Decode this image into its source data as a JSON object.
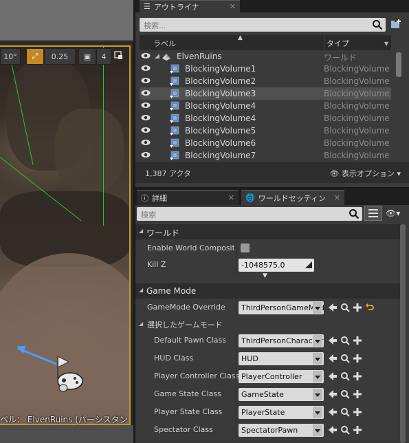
{
  "viewport": {
    "toolbar": {
      "angle": "10°",
      "scale": "0.25",
      "camera_speed": "4"
    },
    "level_label": "ベル： ElvenRuins (パーシスタント)"
  },
  "outliner": {
    "tab_label": "アウトライナ",
    "search_placeholder": "検索...",
    "col_label": "ラベル",
    "col_type": "タイプ",
    "rows": [
      {
        "name": "ElvenRuins",
        "type": "ワールド",
        "kind": "world",
        "selected": false
      },
      {
        "name": "BlockingVolume1",
        "type": "BlockingVolume",
        "kind": "volume",
        "selected": false
      },
      {
        "name": "BlockingVolume2",
        "type": "BlockingVolume",
        "kind": "volume",
        "selected": false
      },
      {
        "name": "BlockingVolume3",
        "type": "BlockingVolume",
        "kind": "volume",
        "selected": true
      },
      {
        "name": "BlockingVolume4",
        "type": "BlockingVolume",
        "kind": "volume",
        "selected": false
      },
      {
        "name": "BlockingVolume4",
        "type": "BlockingVolume",
        "kind": "volume",
        "selected": false
      },
      {
        "name": "BlockingVolume5",
        "type": "BlockingVolume",
        "kind": "volume",
        "selected": false
      },
      {
        "name": "BlockingVolume6",
        "type": "BlockingVolume",
        "kind": "volume",
        "selected": false
      },
      {
        "name": "BlockingVolume7",
        "type": "BlockingVolume",
        "kind": "volume",
        "selected": false
      }
    ],
    "actor_count": "1,387 アクタ",
    "view_options": "表示オプション"
  },
  "details": {
    "tab_details": "詳細",
    "tab_world_settings": "ワールドセッティン",
    "search_placeholder": "検索",
    "section_world": "ワールド",
    "enable_world_composition_label": "Enable World Composition",
    "kill_z_label": "Kill Z",
    "kill_z_value": "-1048575.0",
    "section_game_mode": "Game Mode",
    "gamemode_override_label": "GameMode Override",
    "gamemode_override_value": "ThirdPersonGameMode",
    "selected_game_mode_label": "選択したゲームモード",
    "classes": [
      {
        "label": "Default Pawn Class",
        "value": "ThirdPersonCharacter"
      },
      {
        "label": "HUD Class",
        "value": "HUD"
      },
      {
        "label": "Player Controller Class",
        "value": "PlayerController"
      },
      {
        "label": "Game State Class",
        "value": "GameState"
      },
      {
        "label": "Player State Class",
        "value": "PlayerState"
      },
      {
        "label": "Spectator Class",
        "value": "SpectatorPawn"
      }
    ]
  },
  "colors": {
    "selection_border": "#c89a2c",
    "volume_wire": "#2fbf3a",
    "arrow": "#4d9cff"
  }
}
